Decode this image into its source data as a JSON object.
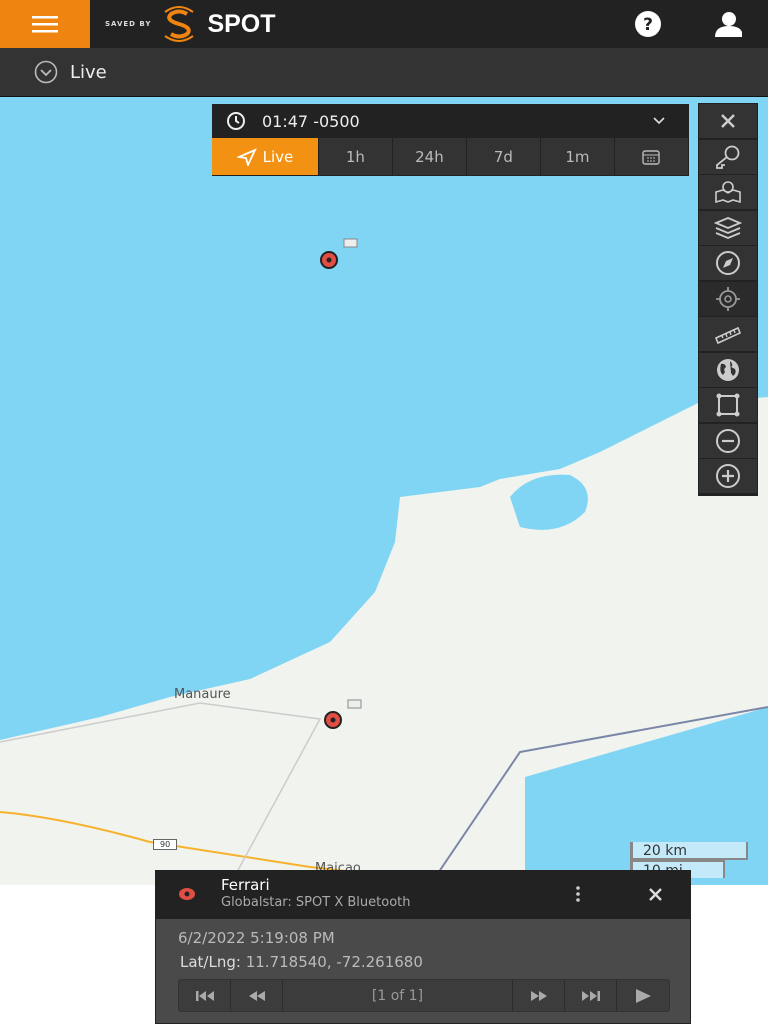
{
  "header": {
    "logo_prefix": "SAVED BY",
    "logo_brand": "SPOT",
    "menu_icon": "hamburger-icon",
    "help_icon": "question-circle-icon",
    "user_icon": "user-icon",
    "brand_color": "#ef8510"
  },
  "subheader": {
    "label": "Live",
    "icon": "chevron-circle-down-icon"
  },
  "time_panel": {
    "time": "01:47 -0500",
    "tabs": [
      {
        "label": "Live",
        "active": true
      },
      {
        "label": "1h"
      },
      {
        "label": "24h"
      },
      {
        "label": "7d"
      },
      {
        "label": "1m"
      }
    ],
    "calendar_icon": "calendar-icon"
  },
  "toolbar": [
    "close-icon",
    "key-icon",
    "map-marker-icon",
    "layers-icon",
    "compass-icon",
    "locate-icon",
    "ruler-icon",
    "globe-icon",
    "select-area-icon",
    "zoom-out-icon",
    "zoom-in-icon"
  ],
  "map": {
    "place_label": "Manaure",
    "road_shield": "90",
    "partial_label": "Maicao",
    "scale_km": "20 km",
    "scale_mi": "10 mi"
  },
  "popup": {
    "name": "Ferrari",
    "device": "Globalstar: SPOT X Bluetooth",
    "datetime": "6/2/2022 5:19:08 PM",
    "latlng_label": "Lat/Lng:",
    "latlng": "11.718540, -72.261680",
    "pager": "[1 of 1]"
  }
}
